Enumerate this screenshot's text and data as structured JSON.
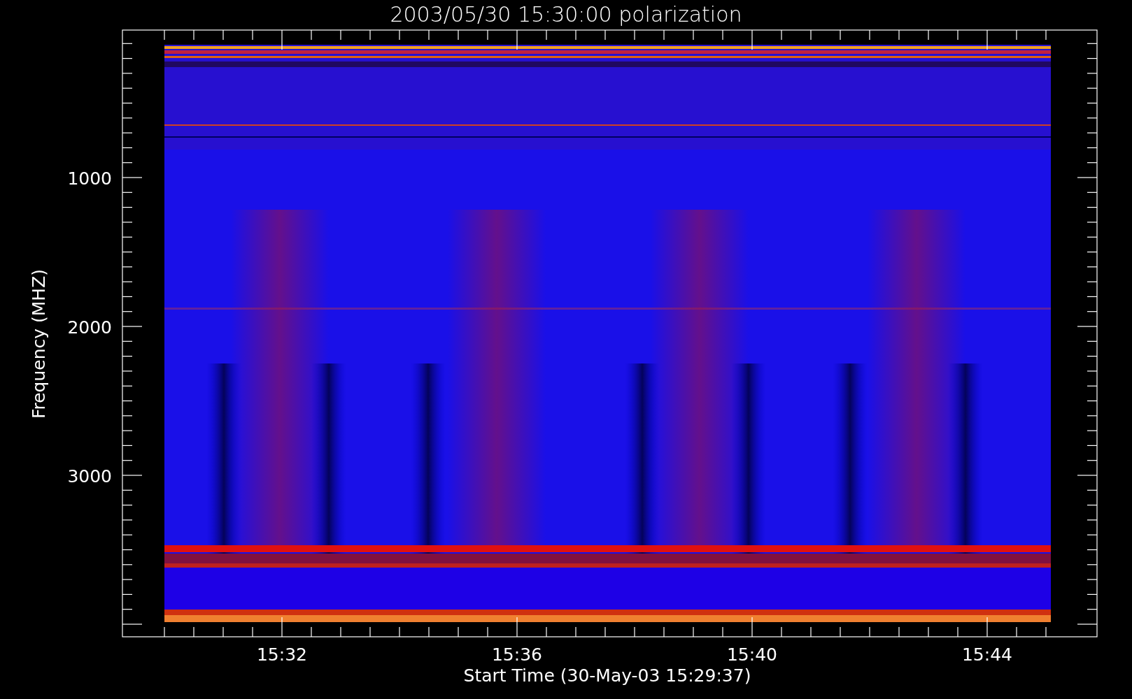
{
  "plot": {
    "title": "2003/05/30 15:30:00 polarization",
    "y_label": "Frequency (MHZ)",
    "x_label": "Start Time (30-May-03 15:29:37)",
    "y_ticks": [
      "1000",
      "2000",
      "3000"
    ],
    "x_ticks": [
      "15:32",
      "15:36",
      "15:40",
      "15:44"
    ]
  }
}
